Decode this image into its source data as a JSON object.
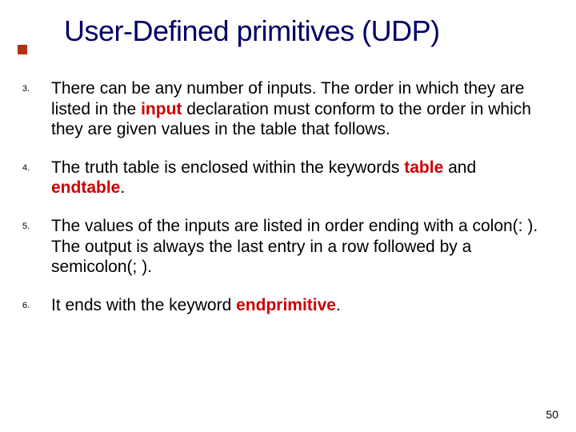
{
  "title": "User-Defined primitives (UDP)",
  "items": [
    {
      "num": "3.",
      "pre1": "There can be any number of inputs. The order in which they are listed in the ",
      "kw1": "input",
      "post1": " declaration must conform to the order in which they are given values in the table that follows."
    },
    {
      "num": "4.",
      "pre1": "The truth table is enclosed within the keywords ",
      "kw1": "table",
      "mid1": " and ",
      "kw2": "endtable",
      "post1": "."
    },
    {
      "num": "5.",
      "pre1": "The values of the inputs are listed in order ending with a colon(: ). The output is always the last entry in a row followed by a semicolon(; )."
    },
    {
      "num": "6.",
      "pre1": "It ends with the keyword ",
      "kw1": "endprimitive",
      "post1": "."
    }
  ],
  "page_number": "50"
}
